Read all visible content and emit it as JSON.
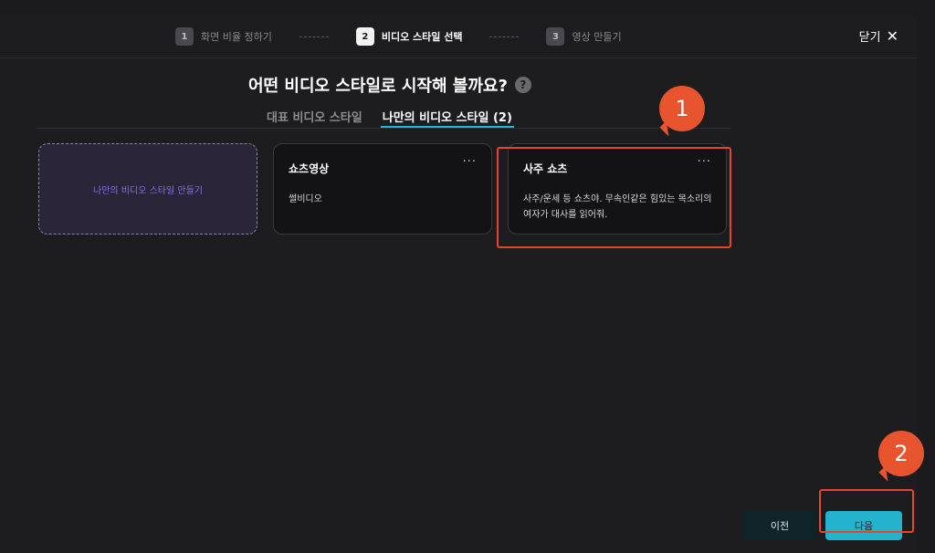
{
  "steps": [
    {
      "num": "1",
      "label": "화면 비율 정하기"
    },
    {
      "num": "2",
      "label": "비디오 스타일 선택"
    },
    {
      "num": "3",
      "label": "영상 만들기"
    }
  ],
  "close": {
    "label": "닫기",
    "icon": "close-icon"
  },
  "heading": {
    "title": "어떤 비디오 스타일로 시작해 볼까요?",
    "help": "?"
  },
  "tabs": [
    {
      "label": "대표 비디오 스타일"
    },
    {
      "label": "나만의 비디오 스타일 (2)"
    }
  ],
  "cards": {
    "create_label": "나만의 비디오 스타일 만들기",
    "items": [
      {
        "title": "쇼츠영상",
        "desc": "썰비디오",
        "more": "···"
      },
      {
        "title": "사주 쇼츠",
        "desc": "사주/운세 등 쇼츠야. 무속인같은 힘있는 목소리의 여자가 대사를 읽어줘.",
        "more": "···"
      }
    ]
  },
  "annotations": {
    "badge1": "1",
    "badge2": "2"
  },
  "footer": {
    "prev": "이전",
    "next": "다음"
  },
  "colors": {
    "accent": "#23b3cd",
    "highlight": "#e4472c",
    "create_text": "#8e6ee8"
  }
}
